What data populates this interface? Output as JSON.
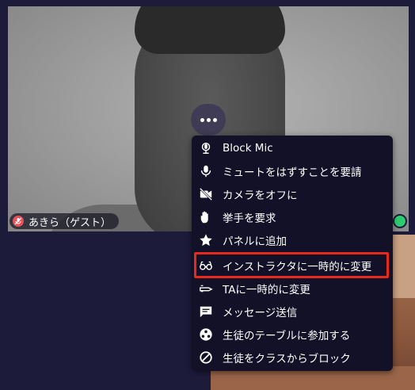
{
  "participant": {
    "name": "あきら（ゲスト）"
  },
  "menu": {
    "items": [
      {
        "label": "Block Mic",
        "icon": "mic-block-icon"
      },
      {
        "label": "ミュートをはずすことを要請",
        "icon": "mic-icon"
      },
      {
        "label": "カメラをオフに",
        "icon": "camera-off-icon"
      },
      {
        "label": "挙手を要求",
        "icon": "hand-icon"
      },
      {
        "label": "パネルに追加",
        "icon": "star-icon"
      },
      {
        "label": "インストラクタに一時的に変更",
        "icon": "glasses-icon"
      },
      {
        "label": "TAに一時的に変更",
        "icon": "ta-icon"
      },
      {
        "label": "メッセージ送信",
        "icon": "message-icon"
      },
      {
        "label": "生徒のテーブルに参加する",
        "icon": "table-icon"
      },
      {
        "label": "生徒をクラスからブロック",
        "icon": "block-icon"
      }
    ]
  },
  "colors": {
    "highlight": "#e8281d",
    "status": "#2ecc71",
    "mic_off": "#e8505b"
  }
}
